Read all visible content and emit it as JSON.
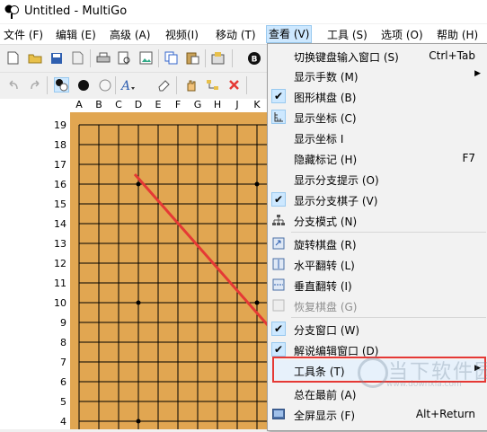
{
  "window": {
    "title": "Untitled - MultiGo"
  },
  "menubar": [
    {
      "label": "文件 (F)",
      "active": false
    },
    {
      "label": "编辑 (E)",
      "active": false
    },
    {
      "label": "高级 (A)",
      "active": false
    },
    {
      "label": "视频(I)",
      "active": false
    },
    {
      "label": "移动 (T)",
      "active": false
    },
    {
      "label": "查看 (V)",
      "active": true
    },
    {
      "label": "工具 (S)",
      "active": false
    },
    {
      "label": "选项 (O)",
      "active": false
    },
    {
      "label": "帮助 (H)",
      "active": false
    }
  ],
  "board": {
    "columns": [
      "A",
      "B",
      "C",
      "D",
      "E",
      "F",
      "G",
      "H",
      "J",
      "K"
    ],
    "rows": [
      "19",
      "18",
      "17",
      "16",
      "15",
      "14",
      "13",
      "12",
      "11",
      "10",
      "9",
      "8",
      "7",
      "6",
      "5",
      "4"
    ],
    "colors": {
      "board": "#e1a651",
      "line": "#000000",
      "arrow": "#e53935"
    }
  },
  "view_menu": {
    "items": [
      {
        "label": "切换键盘输入窗口 (S)",
        "shortcut": "Ctrl+Tab",
        "icon": "",
        "checked": false,
        "disabled": false,
        "submenu": false
      },
      {
        "label": "显示手数 (M)",
        "shortcut": "",
        "icon": "",
        "checked": false,
        "disabled": false,
        "submenu": true
      },
      {
        "label": "图形棋盘 (B)",
        "shortcut": "",
        "icon": "check-icon",
        "checked": true,
        "disabled": false,
        "submenu": false
      },
      {
        "label": "显示坐标 (C)",
        "shortcut": "",
        "icon": "coordinate-icon",
        "checked": true,
        "disabled": false,
        "submenu": false
      },
      {
        "label": "显示坐标 I",
        "shortcut": "",
        "icon": "",
        "checked": false,
        "disabled": false,
        "submenu": false
      },
      {
        "label": "隐藏标记 (H)",
        "shortcut": "F7",
        "icon": "",
        "checked": false,
        "disabled": false,
        "submenu": false
      },
      {
        "label": "显示分支提示 (O)",
        "shortcut": "",
        "icon": "",
        "checked": false,
        "disabled": false,
        "submenu": false
      },
      {
        "label": "显示分支棋子 (V)",
        "shortcut": "",
        "icon": "check-icon",
        "checked": true,
        "disabled": false,
        "submenu": false
      },
      {
        "label": "分支模式 (N)",
        "shortcut": "",
        "icon": "tree-icon",
        "checked": false,
        "disabled": false,
        "submenu": false
      },
      {
        "label": "旋转棋盘 (R)",
        "shortcut": "",
        "icon": "rotate-icon",
        "checked": false,
        "disabled": false,
        "submenu": false
      },
      {
        "label": "水平翻转 (L)",
        "shortcut": "",
        "icon": "flip-horizontal-icon",
        "checked": false,
        "disabled": false,
        "submenu": false
      },
      {
        "label": "垂直翻转 (I)",
        "shortcut": "",
        "icon": "flip-vertical-icon",
        "checked": false,
        "disabled": false,
        "submenu": false
      },
      {
        "label": "恢复棋盘 (G)",
        "shortcut": "",
        "icon": "restore-icon",
        "checked": false,
        "disabled": true,
        "submenu": false
      },
      {
        "label": "分支窗口 (W)",
        "shortcut": "",
        "icon": "check-icon",
        "checked": true,
        "disabled": false,
        "submenu": false
      },
      {
        "label": "解说编辑窗口 (D)",
        "shortcut": "",
        "icon": "check-icon",
        "checked": true,
        "disabled": false,
        "submenu": false
      },
      {
        "label": "工具条 (T)",
        "shortcut": "",
        "icon": "",
        "checked": false,
        "disabled": false,
        "submenu": true
      },
      {
        "label": "总在最前 (A)",
        "shortcut": "",
        "icon": "",
        "checked": false,
        "disabled": false,
        "submenu": false
      },
      {
        "label": "全屏显示 (F)",
        "shortcut": "Alt+Return",
        "icon": "fullscreen-icon",
        "checked": false,
        "disabled": false,
        "submenu": false
      }
    ]
  },
  "watermark": {
    "text": "当下软件园",
    "sub": "www.downxia.com"
  }
}
